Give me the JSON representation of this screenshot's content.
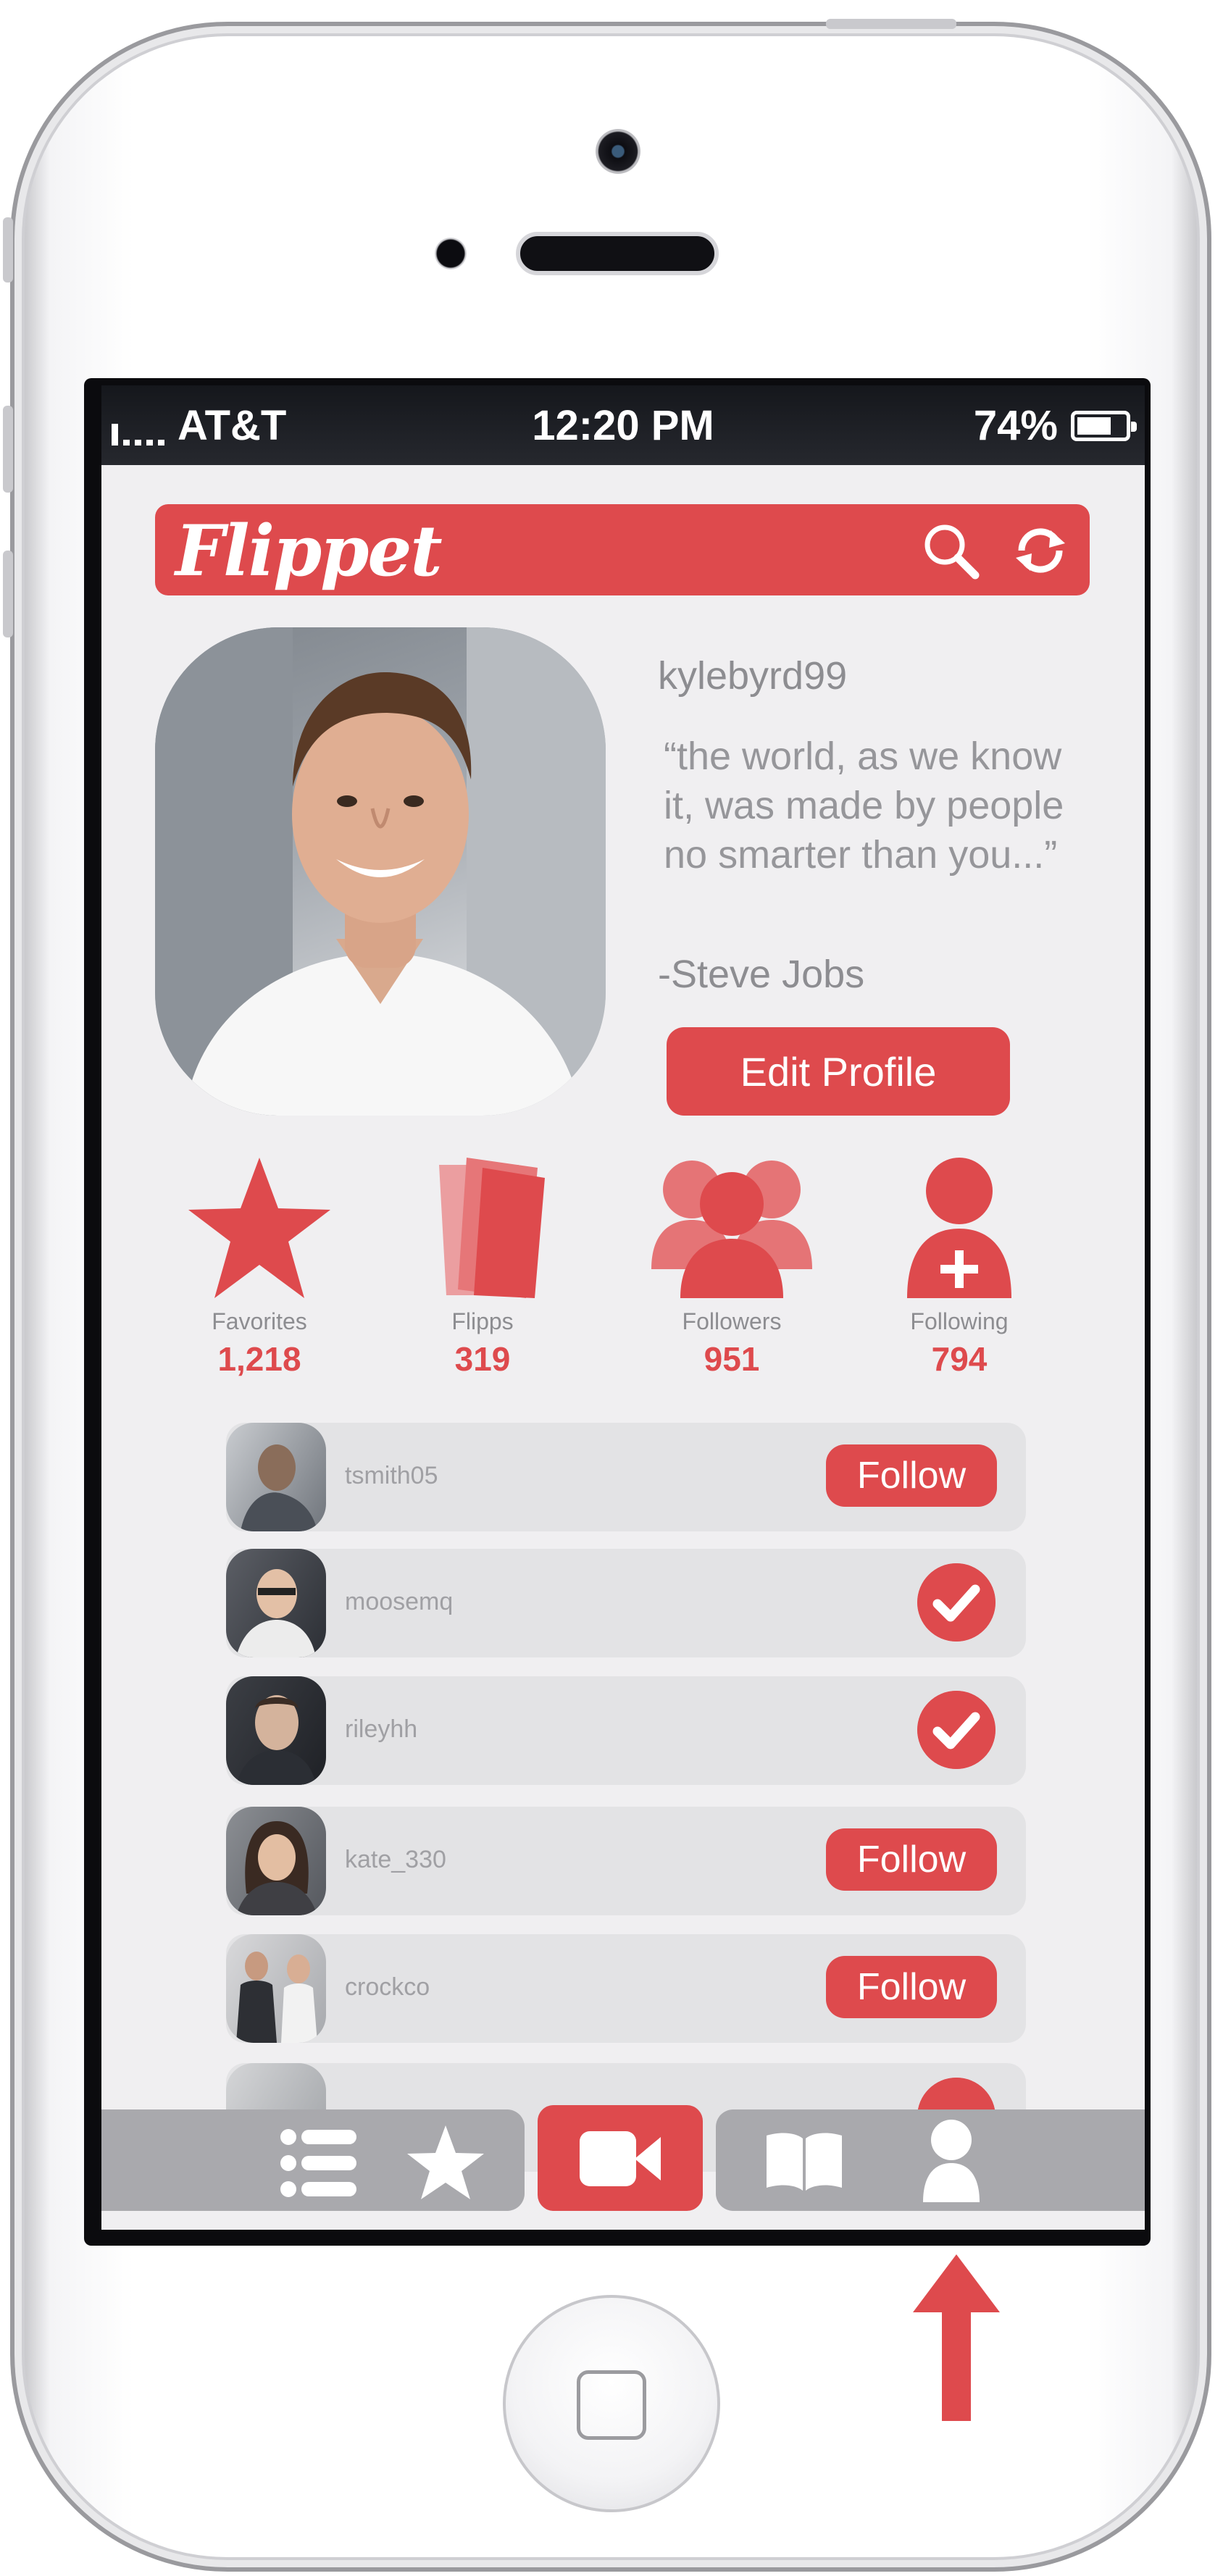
{
  "status_bar": {
    "carrier": "AT&T",
    "time": "12:20 PM",
    "battery": "74%",
    "battery_level": 0.74
  },
  "header": {
    "logo": "Flippet",
    "icons": [
      "search-icon",
      "refresh-icon"
    ]
  },
  "profile": {
    "username": "kylebyrd99",
    "quote": "“the world, as we know it, was made by people no smarter than you...”",
    "author": "-Steve Jobs",
    "edit_button": "Edit Profile"
  },
  "stats": [
    {
      "icon": "star-icon",
      "label": "Favorites",
      "value": "1,218"
    },
    {
      "icon": "cards-icon",
      "label": "Flipps",
      "value": "319"
    },
    {
      "icon": "group-icon",
      "label": "Followers",
      "value": "951"
    },
    {
      "icon": "add-user-icon",
      "label": "Following",
      "value": "794"
    }
  ],
  "people": [
    {
      "name": "tsmith05",
      "action": "Follow"
    },
    {
      "name": "moosemq",
      "action": "following"
    },
    {
      "name": "rileyhh",
      "action": "following"
    },
    {
      "name": "kate_330",
      "action": "Follow"
    },
    {
      "name": "crockco",
      "action": "Follow"
    }
  ],
  "tabbar": {
    "tabs": [
      "list-icon",
      "star-icon",
      "video-camera-icon",
      "book-icon",
      "profile-icon"
    ],
    "active": "video-camera-icon"
  },
  "colors": {
    "accent": "#de4a4d",
    "background": "#f0eff1",
    "row": "#e3e3e5",
    "tab": "#a9a9ad"
  }
}
